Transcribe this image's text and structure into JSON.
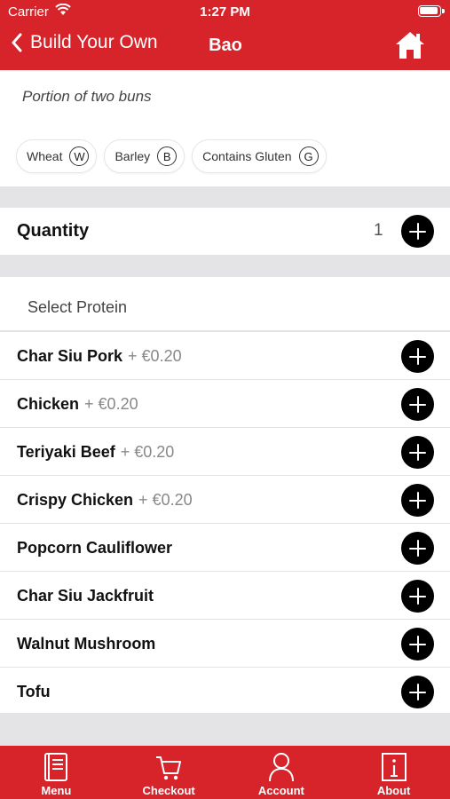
{
  "status_bar": {
    "carrier": "Carrier",
    "time": "1:27 PM"
  },
  "nav": {
    "back_label": "Build Your Own",
    "title": "Bao"
  },
  "description": "Portion of two buns",
  "allergens": [
    {
      "label": "Wheat",
      "code": "W"
    },
    {
      "label": "Barley",
      "code": "B"
    },
    {
      "label": "Contains Gluten",
      "code": "G"
    }
  ],
  "quantity": {
    "label": "Quantity",
    "value": "1"
  },
  "protein": {
    "header": "Select Protein",
    "items": [
      {
        "name": "Char Siu Pork",
        "price": "+ €0.20"
      },
      {
        "name": "Chicken",
        "price": "+ €0.20"
      },
      {
        "name": "Teriyaki Beef",
        "price": "+ €0.20"
      },
      {
        "name": "Crispy Chicken",
        "price": "+ €0.20"
      },
      {
        "name": "Popcorn Cauliflower",
        "price": ""
      },
      {
        "name": "Char Siu Jackfruit",
        "price": ""
      },
      {
        "name": "Walnut Mushroom",
        "price": ""
      },
      {
        "name": "Tofu",
        "price": ""
      }
    ]
  },
  "tabs": [
    {
      "label": "Menu",
      "icon": "menu-book-icon"
    },
    {
      "label": "Checkout",
      "icon": "cart-icon"
    },
    {
      "label": "Account",
      "icon": "person-icon"
    },
    {
      "label": "About",
      "icon": "info-icon"
    }
  ],
  "colors": {
    "brand_red": "#d6242a",
    "background_gray": "#e4e4e6"
  }
}
